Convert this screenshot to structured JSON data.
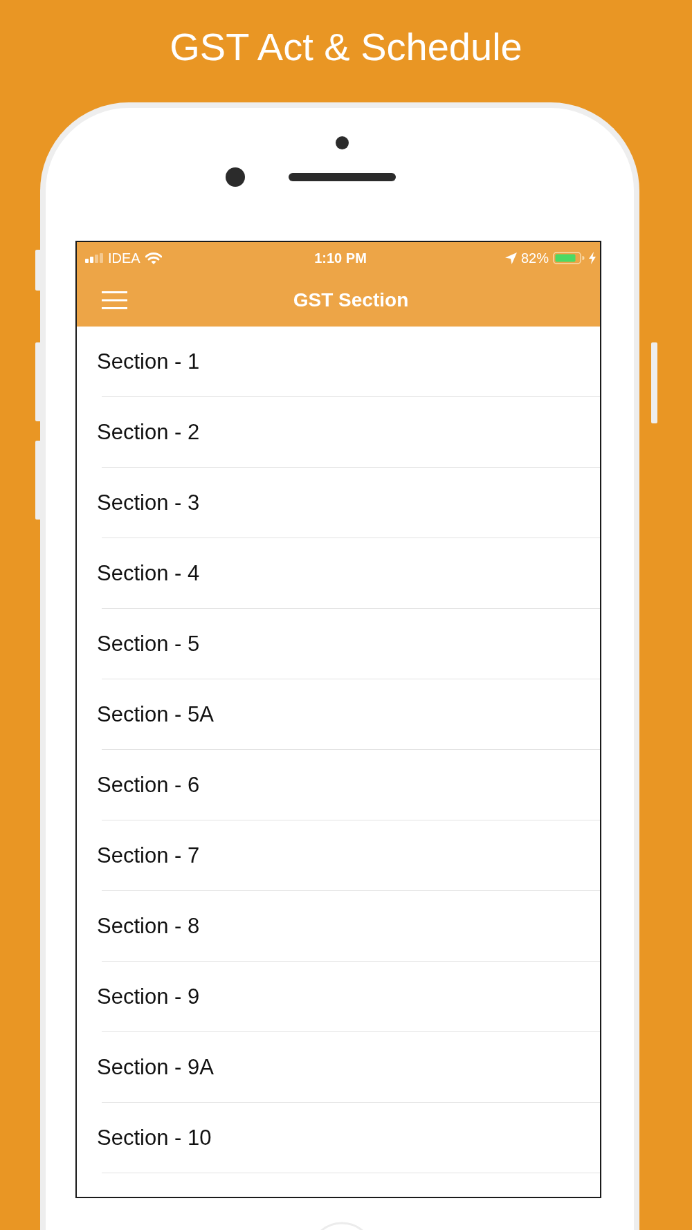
{
  "page_title": "GST Act & Schedule",
  "status_bar": {
    "carrier": "IDEA",
    "time": "1:10 PM",
    "battery": "82%"
  },
  "nav_bar": {
    "title": "GST Section"
  },
  "sections": [
    "Section - 1",
    "Section - 2",
    "Section - 3",
    "Section - 4",
    "Section - 5",
    "Section - 5A",
    "Section - 6",
    "Section - 7",
    "Section - 8",
    "Section - 9",
    "Section - 9A",
    "Section - 10"
  ]
}
